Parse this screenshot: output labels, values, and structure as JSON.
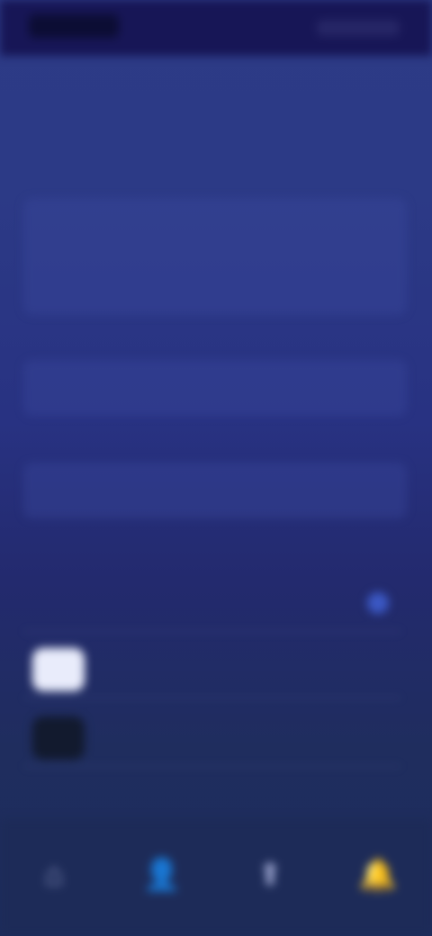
{
  "status": {
    "left": "",
    "right": ""
  },
  "header": {
    "title": ""
  },
  "sections": [
    {
      "label": ""
    },
    {
      "label": ""
    },
    {
      "label": ""
    },
    {
      "label": ""
    }
  ],
  "panels": [
    {
      "value": ""
    },
    {
      "value": ""
    }
  ],
  "rows": [
    {
      "label": ""
    },
    {
      "label": ""
    },
    {
      "label": ""
    },
    {
      "label": ""
    }
  ],
  "bottom_nav": [
    {
      "icon": "home-icon",
      "label": ""
    },
    {
      "icon": "person-icon",
      "label": ""
    },
    {
      "icon": "upload-icon",
      "label": ""
    },
    {
      "icon": "bell-icon",
      "label": ""
    }
  ],
  "colors": {
    "background": "#2c3a86",
    "accent": "#3b58c4",
    "status_bar": "#171656"
  }
}
